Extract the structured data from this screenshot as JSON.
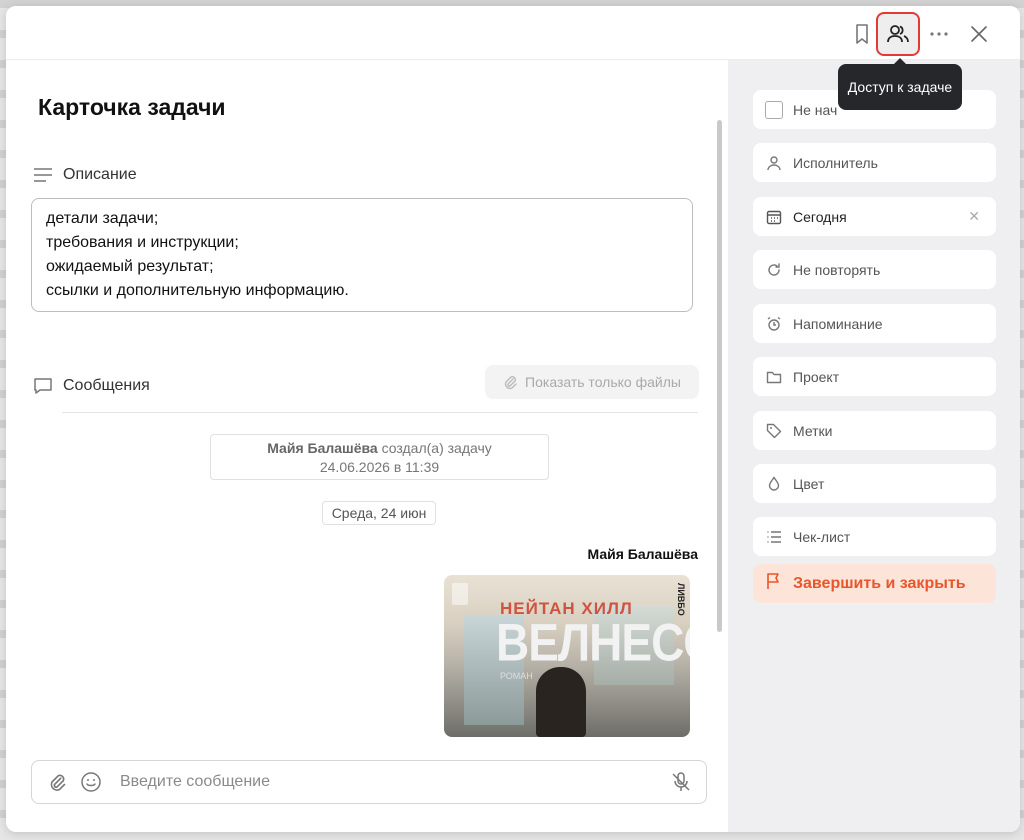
{
  "toolbar": {
    "bookmark_icon": "bookmark-icon",
    "access_icon": "users-icon",
    "more_icon": "more-icon",
    "close_icon": "close-icon",
    "tooltip": "Доступ к задаче"
  },
  "card": {
    "title": "Карточка задачи",
    "description_label": "Описание",
    "description_lines": [
      "детали задачи;",
      "требования и инструкции;",
      "ожидаемый результат;",
      "ссылки и дополнительную информацию."
    ]
  },
  "messages": {
    "label": "Сообщения",
    "files_button": "Показать только файлы",
    "system": {
      "author": "Майя Балашёва",
      "action": "создал(а) задачу",
      "datetime": "24.06.2026 в 11:39"
    },
    "date_chip": "Среда, 24 июн",
    "message_author": "Майя Балашёва",
    "book": {
      "author": "НЕЙТАН ХИЛЛ",
      "name": "ВЕЛНЕСС",
      "subtitle": "РОМАН",
      "publisher": "ЛИВБО"
    }
  },
  "composer": {
    "placeholder": "Введите сообщение"
  },
  "sidebar": {
    "status": "Не нач",
    "assignee": "Исполнитель",
    "date": "Сегодня",
    "repeat": "Не повторять",
    "reminder": "Напоминание",
    "project": "Проект",
    "tags": "Метки",
    "color": "Цвет",
    "checklist": "Чек-лист",
    "finish": "Завершить и закрыть"
  },
  "colors": {
    "accent_orange": "#e8562b",
    "finish_bg": "#fde4d8",
    "sidebar_bg": "#efeff1",
    "active_outline": "#e53935"
  }
}
